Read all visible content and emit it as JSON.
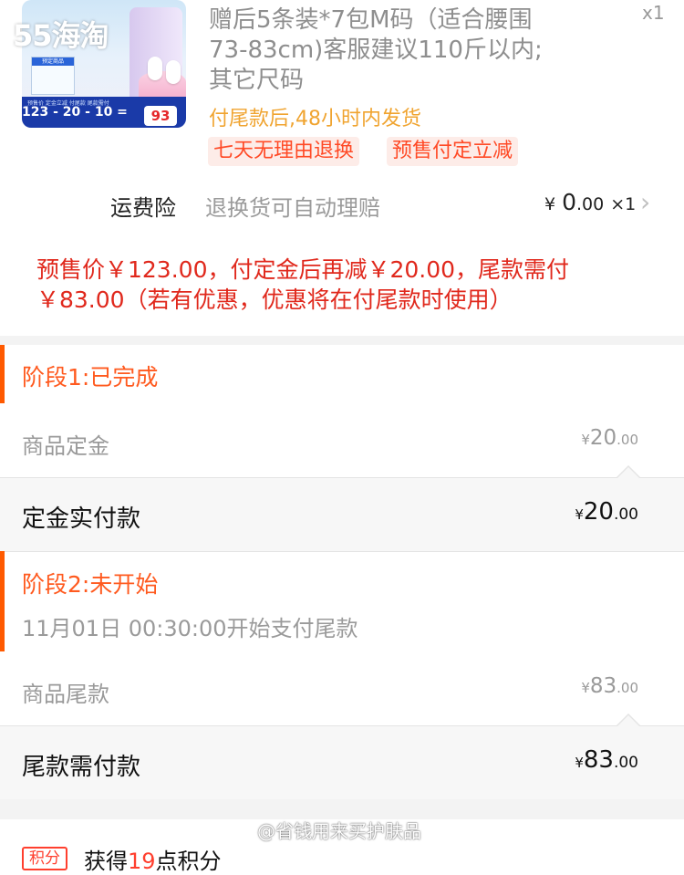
{
  "product": {
    "thumb": {
      "mini_card_text": "预定商品",
      "strip_labels": "预售价  定金立减  付尾款  尾款需付",
      "equation": "123 - 20 - 10 =",
      "final_label": "尾款需付",
      "final_price": "93"
    },
    "watermark_logo": "55海淘",
    "description": "赠后5条装*7包M码（适合腰围73-83cm)客服建议110斤以内;其它尺码",
    "quantity": "x1",
    "ship_note": "付尾款后,48小时内发货",
    "tags": [
      "七天无理由退换",
      "预售付定立减"
    ]
  },
  "insurance": {
    "title": "运费险",
    "description": "退换货可自动理赔",
    "price_currency": "¥",
    "price_int": "0",
    "price_dec": ".00",
    "quantity": "×1"
  },
  "presale_note": "预售价￥123.00，付定金后再减￥20.00，尾款需付￥83.00（若有优惠，优惠将在付尾款时使用）",
  "stage1": {
    "title": "阶段1:已完成",
    "row_label": "商品定金",
    "row_currency": "¥",
    "row_int": "20",
    "row_dec": ".00",
    "pay_label": "定金实付款",
    "pay_currency": "¥",
    "pay_int": "20",
    "pay_dec": ".00"
  },
  "stage2": {
    "title": "阶段2:未开始",
    "subtitle": "11月01日 00:30:00开始支付尾款",
    "row_label": "商品尾款",
    "row_currency": "¥",
    "row_int": "83",
    "row_dec": ".00",
    "pay_label": "尾款需付款",
    "pay_currency": "¥",
    "pay_int": "83",
    "pay_dec": ".00"
  },
  "footer": {
    "watermark": "@省钱用来买护肤品",
    "points_badge": "积分",
    "points_prefix": "获得",
    "points_value": "19",
    "points_suffix": "点积分"
  },
  "colors": {
    "accent_orange": "#ff5a00",
    "note_red": "#e0281c",
    "ship_yellow": "#f0a430",
    "tag_bg": "#fdece8"
  }
}
